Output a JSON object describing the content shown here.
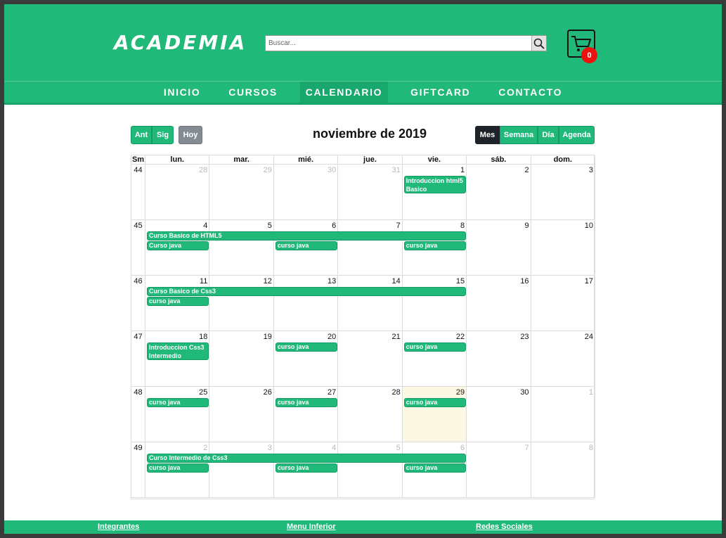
{
  "header": {
    "logo": "ACADEMIA",
    "search_placeholder": "Buscar...",
    "cart_count": "0",
    "nav": [
      "INICIO",
      "CURSOS",
      "CALENDARIO",
      "GIFTCARD",
      "CONTACTO"
    ],
    "active_nav": "CALENDARIO"
  },
  "calendar": {
    "prev_label": "Ant",
    "next_label": "Sig",
    "today_label": "Hoy",
    "title": "noviembre de 2019",
    "views": [
      "Mes",
      "Semana",
      "Día",
      "Agenda"
    ],
    "active_view": "Mes",
    "headers": [
      "Sm",
      "lun.",
      "mar.",
      "mié.",
      "jue.",
      "vie.",
      "sáb.",
      "dom."
    ],
    "weeks": [
      {
        "wk": "44",
        "days": [
          "28",
          "29",
          "30",
          "31",
          "1",
          "2",
          "3"
        ],
        "other": [
          true,
          true,
          true,
          true,
          false,
          false,
          false
        ]
      },
      {
        "wk": "45",
        "days": [
          "4",
          "5",
          "6",
          "7",
          "8",
          "9",
          "10"
        ],
        "other": [
          false,
          false,
          false,
          false,
          false,
          false,
          false
        ]
      },
      {
        "wk": "46",
        "days": [
          "11",
          "12",
          "13",
          "14",
          "15",
          "16",
          "17"
        ],
        "other": [
          false,
          false,
          false,
          false,
          false,
          false,
          false
        ]
      },
      {
        "wk": "47",
        "days": [
          "18",
          "19",
          "20",
          "21",
          "22",
          "23",
          "24"
        ],
        "other": [
          false,
          false,
          false,
          false,
          false,
          false,
          false
        ]
      },
      {
        "wk": "48",
        "days": [
          "25",
          "26",
          "27",
          "28",
          "29",
          "30",
          "1"
        ],
        "other": [
          false,
          false,
          false,
          false,
          false,
          false,
          true
        ]
      },
      {
        "wk": "49",
        "days": [
          "2",
          "3",
          "4",
          "5",
          "6",
          "7",
          "8"
        ],
        "other": [
          true,
          true,
          true,
          true,
          true,
          true,
          true
        ]
      }
    ],
    "today": {
      "week": 4,
      "col": 4
    },
    "events": [
      {
        "week": 0,
        "start": 4,
        "span": 1,
        "lane": 0,
        "tall": true,
        "title": "Introduccion html5 Basico"
      },
      {
        "week": 1,
        "start": 0,
        "span": 5,
        "lane": 0,
        "tall": false,
        "title": "Curso Basico de HTML5"
      },
      {
        "week": 1,
        "start": 0,
        "span": 1,
        "lane": 1,
        "tall": false,
        "title": "Curso java"
      },
      {
        "week": 1,
        "start": 2,
        "span": 1,
        "lane": 1,
        "tall": false,
        "title": "curso java"
      },
      {
        "week": 1,
        "start": 4,
        "span": 1,
        "lane": 1,
        "tall": false,
        "title": "curso java"
      },
      {
        "week": 2,
        "start": 0,
        "span": 5,
        "lane": 0,
        "tall": false,
        "title": "Curso Basico de Css3"
      },
      {
        "week": 2,
        "start": 0,
        "span": 1,
        "lane": 1,
        "tall": false,
        "title": "curso java"
      },
      {
        "week": 3,
        "start": 0,
        "span": 1,
        "lane": 0,
        "tall": true,
        "title": "Introduccion Css3 Intermedio"
      },
      {
        "week": 3,
        "start": 2,
        "span": 1,
        "lane": 0,
        "tall": false,
        "title": "curso java"
      },
      {
        "week": 3,
        "start": 4,
        "span": 1,
        "lane": 0,
        "tall": false,
        "title": "curso java"
      },
      {
        "week": 4,
        "start": 0,
        "span": 1,
        "lane": 0,
        "tall": false,
        "title": "curso java"
      },
      {
        "week": 4,
        "start": 2,
        "span": 1,
        "lane": 0,
        "tall": false,
        "title": "curso java"
      },
      {
        "week": 4,
        "start": 4,
        "span": 1,
        "lane": 0,
        "tall": false,
        "title": "curso java"
      },
      {
        "week": 5,
        "start": 0,
        "span": 5,
        "lane": 0,
        "tall": false,
        "title": "Curso Intermedio de Css3"
      },
      {
        "week": 5,
        "start": 0,
        "span": 1,
        "lane": 1,
        "tall": false,
        "title": "curso java"
      },
      {
        "week": 5,
        "start": 2,
        "span": 1,
        "lane": 1,
        "tall": false,
        "title": "curso java"
      },
      {
        "week": 5,
        "start": 4,
        "span": 1,
        "lane": 1,
        "tall": false,
        "title": "curso java"
      }
    ]
  },
  "footer": {
    "links": [
      "Integrantes",
      "Menu Inferior",
      "Redes Sociales"
    ]
  }
}
